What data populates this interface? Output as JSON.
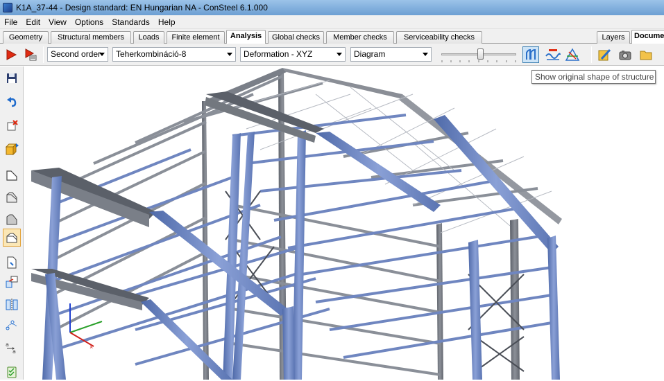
{
  "window": {
    "title": "K1A_37-44 - Design standard: EN Hungarian NA - ConSteel 6.1.000"
  },
  "menu": [
    "File",
    "Edit",
    "View",
    "Options",
    "Standards",
    "Help"
  ],
  "tabs": {
    "items": [
      "Geometry",
      "Structural members",
      "Loads",
      "Finite element",
      "Analysis",
      "Global checks",
      "Member checks",
      "Serviceability checks"
    ],
    "active": "Analysis",
    "right_items": [
      "Layers",
      "Documentation"
    ]
  },
  "toolbar": {
    "analysis_type": "Second order",
    "load_combination": "Teherkombináció-8",
    "result_component": "Deformation - XYZ",
    "display_mode": "Diagram",
    "deformation_scale_fraction": 0.52
  },
  "tooltip": {
    "text": "Show original shape of structure"
  },
  "icons": {
    "run": "run-analysis-icon",
    "run_settings": "analysis-settings-icon",
    "original_shape": "show-original-shape-icon",
    "diagram": "diagram-icon",
    "deformed_shape": "deformed-shape-icon",
    "edit": "edit-documentation-icon",
    "camera": "camera-icon",
    "folder": "folder-icon"
  },
  "colors": {
    "member_blue": "#6f86c0",
    "member_grey": "#6b7079",
    "accent_orange": "#e3a43b",
    "run_red": "#e02b12"
  }
}
